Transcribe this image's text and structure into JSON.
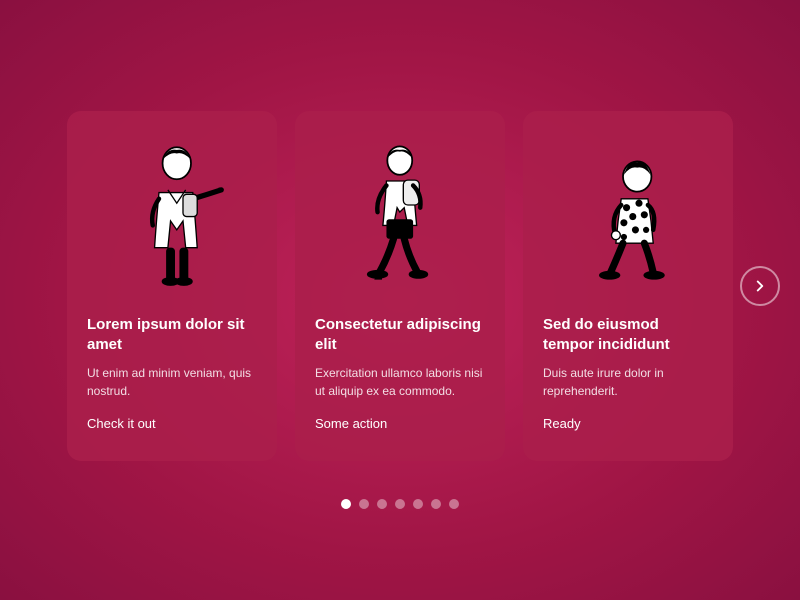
{
  "background": {
    "color": "#b01a4a"
  },
  "cards": [
    {
      "id": "card-1",
      "title": "Lorem ipsum dolor sit amet",
      "description": "Ut enim ad minim veniam, quis nostrud.",
      "link": "Check it out",
      "figure": "person-pointing"
    },
    {
      "id": "card-2",
      "title": "Consectetur adipiscing elit",
      "description": "Exercitation ullamco laboris nisi ut aliquip ex ea commodo.",
      "link": "Some action",
      "figure": "person-walking"
    },
    {
      "id": "card-3",
      "title": "Sed do eiusmod tempor incididunt",
      "description": "Duis aute irure dolor in reprehenderit.",
      "link": "Ready",
      "figure": "person-crouching"
    }
  ],
  "dots": [
    {
      "active": true
    },
    {
      "active": false
    },
    {
      "active": false
    },
    {
      "active": false
    },
    {
      "active": false
    },
    {
      "active": false
    },
    {
      "active": false
    }
  ],
  "next_button": {
    "label": "Next"
  }
}
